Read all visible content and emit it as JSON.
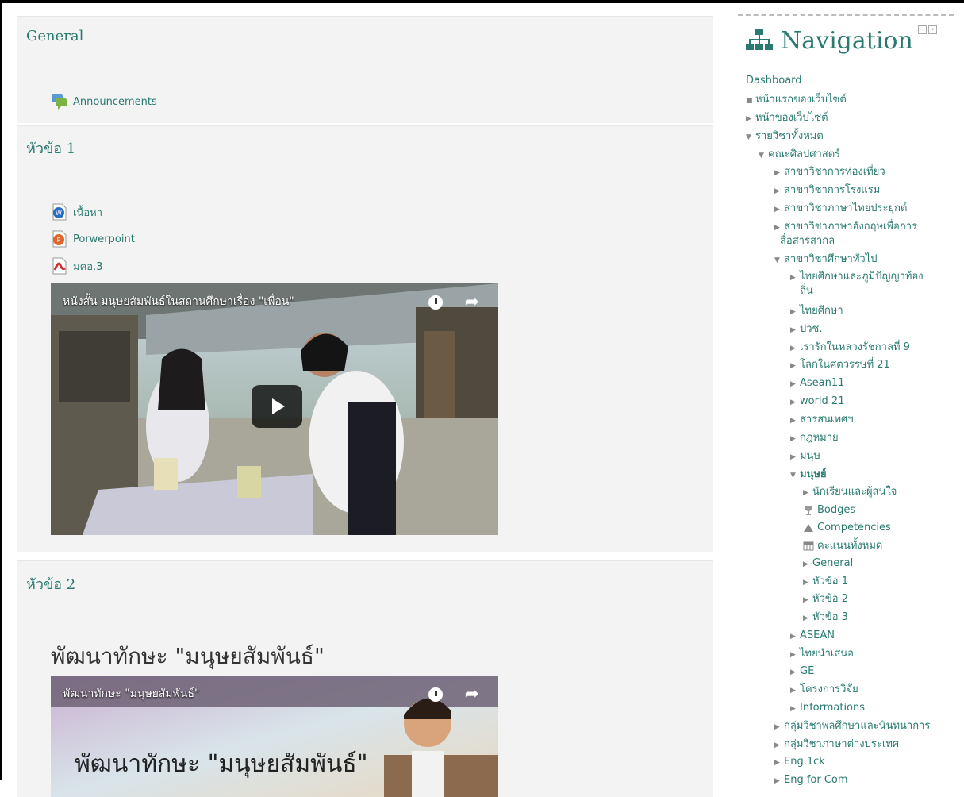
{
  "sections": [
    {
      "title": "General",
      "activities": [
        {
          "label": "Announcements",
          "icon": "forum-icon"
        }
      ]
    },
    {
      "title": "หัวข้อ 1",
      "activities": [
        {
          "label": "เนื้อหา",
          "icon": "word-doc-icon"
        },
        {
          "label": "Porwerpoint",
          "icon": "powerpoint-icon"
        },
        {
          "label": "มคอ.3",
          "icon": "pdf-icon"
        }
      ],
      "video": {
        "title": "หนังสั้น มนุษยสัมพันธ์ในสถานศึกษาเรื่อง \"เพื่อน\""
      }
    },
    {
      "title": "หัวข้อ 2",
      "heading": "พัฒนาทักษะ \"มนุษยสัมพันธ์\"",
      "video": {
        "title": "พัฒนาทักษะ \"มนุษยสัมพันธ์\"",
        "overlay_text": "พัฒนาทักษะ \"มนุษยสัมพันธ์\""
      }
    }
  ],
  "navigation": {
    "title": "Navigation",
    "items": [
      {
        "label": "Dashboard",
        "marker": ""
      },
      {
        "label": "หน้าแรกของเว็บไซต์",
        "marker": "■"
      },
      {
        "label": "หน้าของเว็บไซต์",
        "marker": "▶"
      },
      {
        "label": "รายวิชาทั้งหมด",
        "marker": "▼"
      },
      {
        "label": "คณะศิลปศาสตร์",
        "marker": "▼"
      },
      {
        "label": "สาขาวิชาการท่องเที่ยว",
        "marker": "▶"
      },
      {
        "label": "สาขาวิชาการโรงแรม",
        "marker": "▶"
      },
      {
        "label": "สาขาวิชาภาษาไทยประยุกต์",
        "marker": "▶"
      },
      {
        "label": "สาขาวิชาภาษาอังกฤษเพื่อการ",
        "marker": "▶"
      },
      {
        "label": "สื่อสารสากล",
        "marker": ""
      },
      {
        "label": "สาขาวิชาศึกษาทั่วไป",
        "marker": "▼"
      },
      {
        "label": "ไทยศึกษาและภูมิปัญญาท้อง",
        "marker": "▶"
      },
      {
        "label": "ถิ่น",
        "marker": ""
      },
      {
        "label": "ไทยศึกษา",
        "marker": "▶"
      },
      {
        "label": "ปวช.",
        "marker": "▶"
      },
      {
        "label": "เรารักในหลวงรัชกาลที่ 9",
        "marker": "▶"
      },
      {
        "label": "โลกในศตวรรษที่ 21",
        "marker": "▶"
      },
      {
        "label": "Asean11",
        "marker": "▶"
      },
      {
        "label": "world 21",
        "marker": "▶"
      },
      {
        "label": "สารสนเทศฯ",
        "marker": "▶"
      },
      {
        "label": "กฎหมาย",
        "marker": "▶"
      },
      {
        "label": "มนุษ",
        "marker": "▶"
      },
      {
        "label": "มนุษย์",
        "marker": "▼"
      },
      {
        "label": "นักเรียนและผู้สนใจ",
        "marker": "▶"
      },
      {
        "label": "Bodges",
        "marker": ""
      },
      {
        "label": "Competencies",
        "marker": ""
      },
      {
        "label": "คะแนนทั้งหมด",
        "marker": ""
      },
      {
        "label": "General",
        "marker": "▶"
      },
      {
        "label": "หัวข้อ 1",
        "marker": "▶"
      },
      {
        "label": "หัวข้อ 2",
        "marker": "▶"
      },
      {
        "label": "หัวข้อ 3",
        "marker": "▶"
      },
      {
        "label": "ASEAN",
        "marker": "▶"
      },
      {
        "label": "ไทยนำเสนอ",
        "marker": "▶"
      },
      {
        "label": "GE",
        "marker": "▶"
      },
      {
        "label": "โครงการวิจัย",
        "marker": "▶"
      },
      {
        "label": "Informations",
        "marker": "▶"
      },
      {
        "label": "กลุ่มวิชาพลศึกษาและนันทนาการ",
        "marker": "▶"
      },
      {
        "label": "กลุ่มวิชาภาษาต่างประเทศ",
        "marker": "▶"
      },
      {
        "label": "Eng.1ck",
        "marker": "▶"
      },
      {
        "label": "Eng for Com",
        "marker": "▶"
      }
    ]
  }
}
